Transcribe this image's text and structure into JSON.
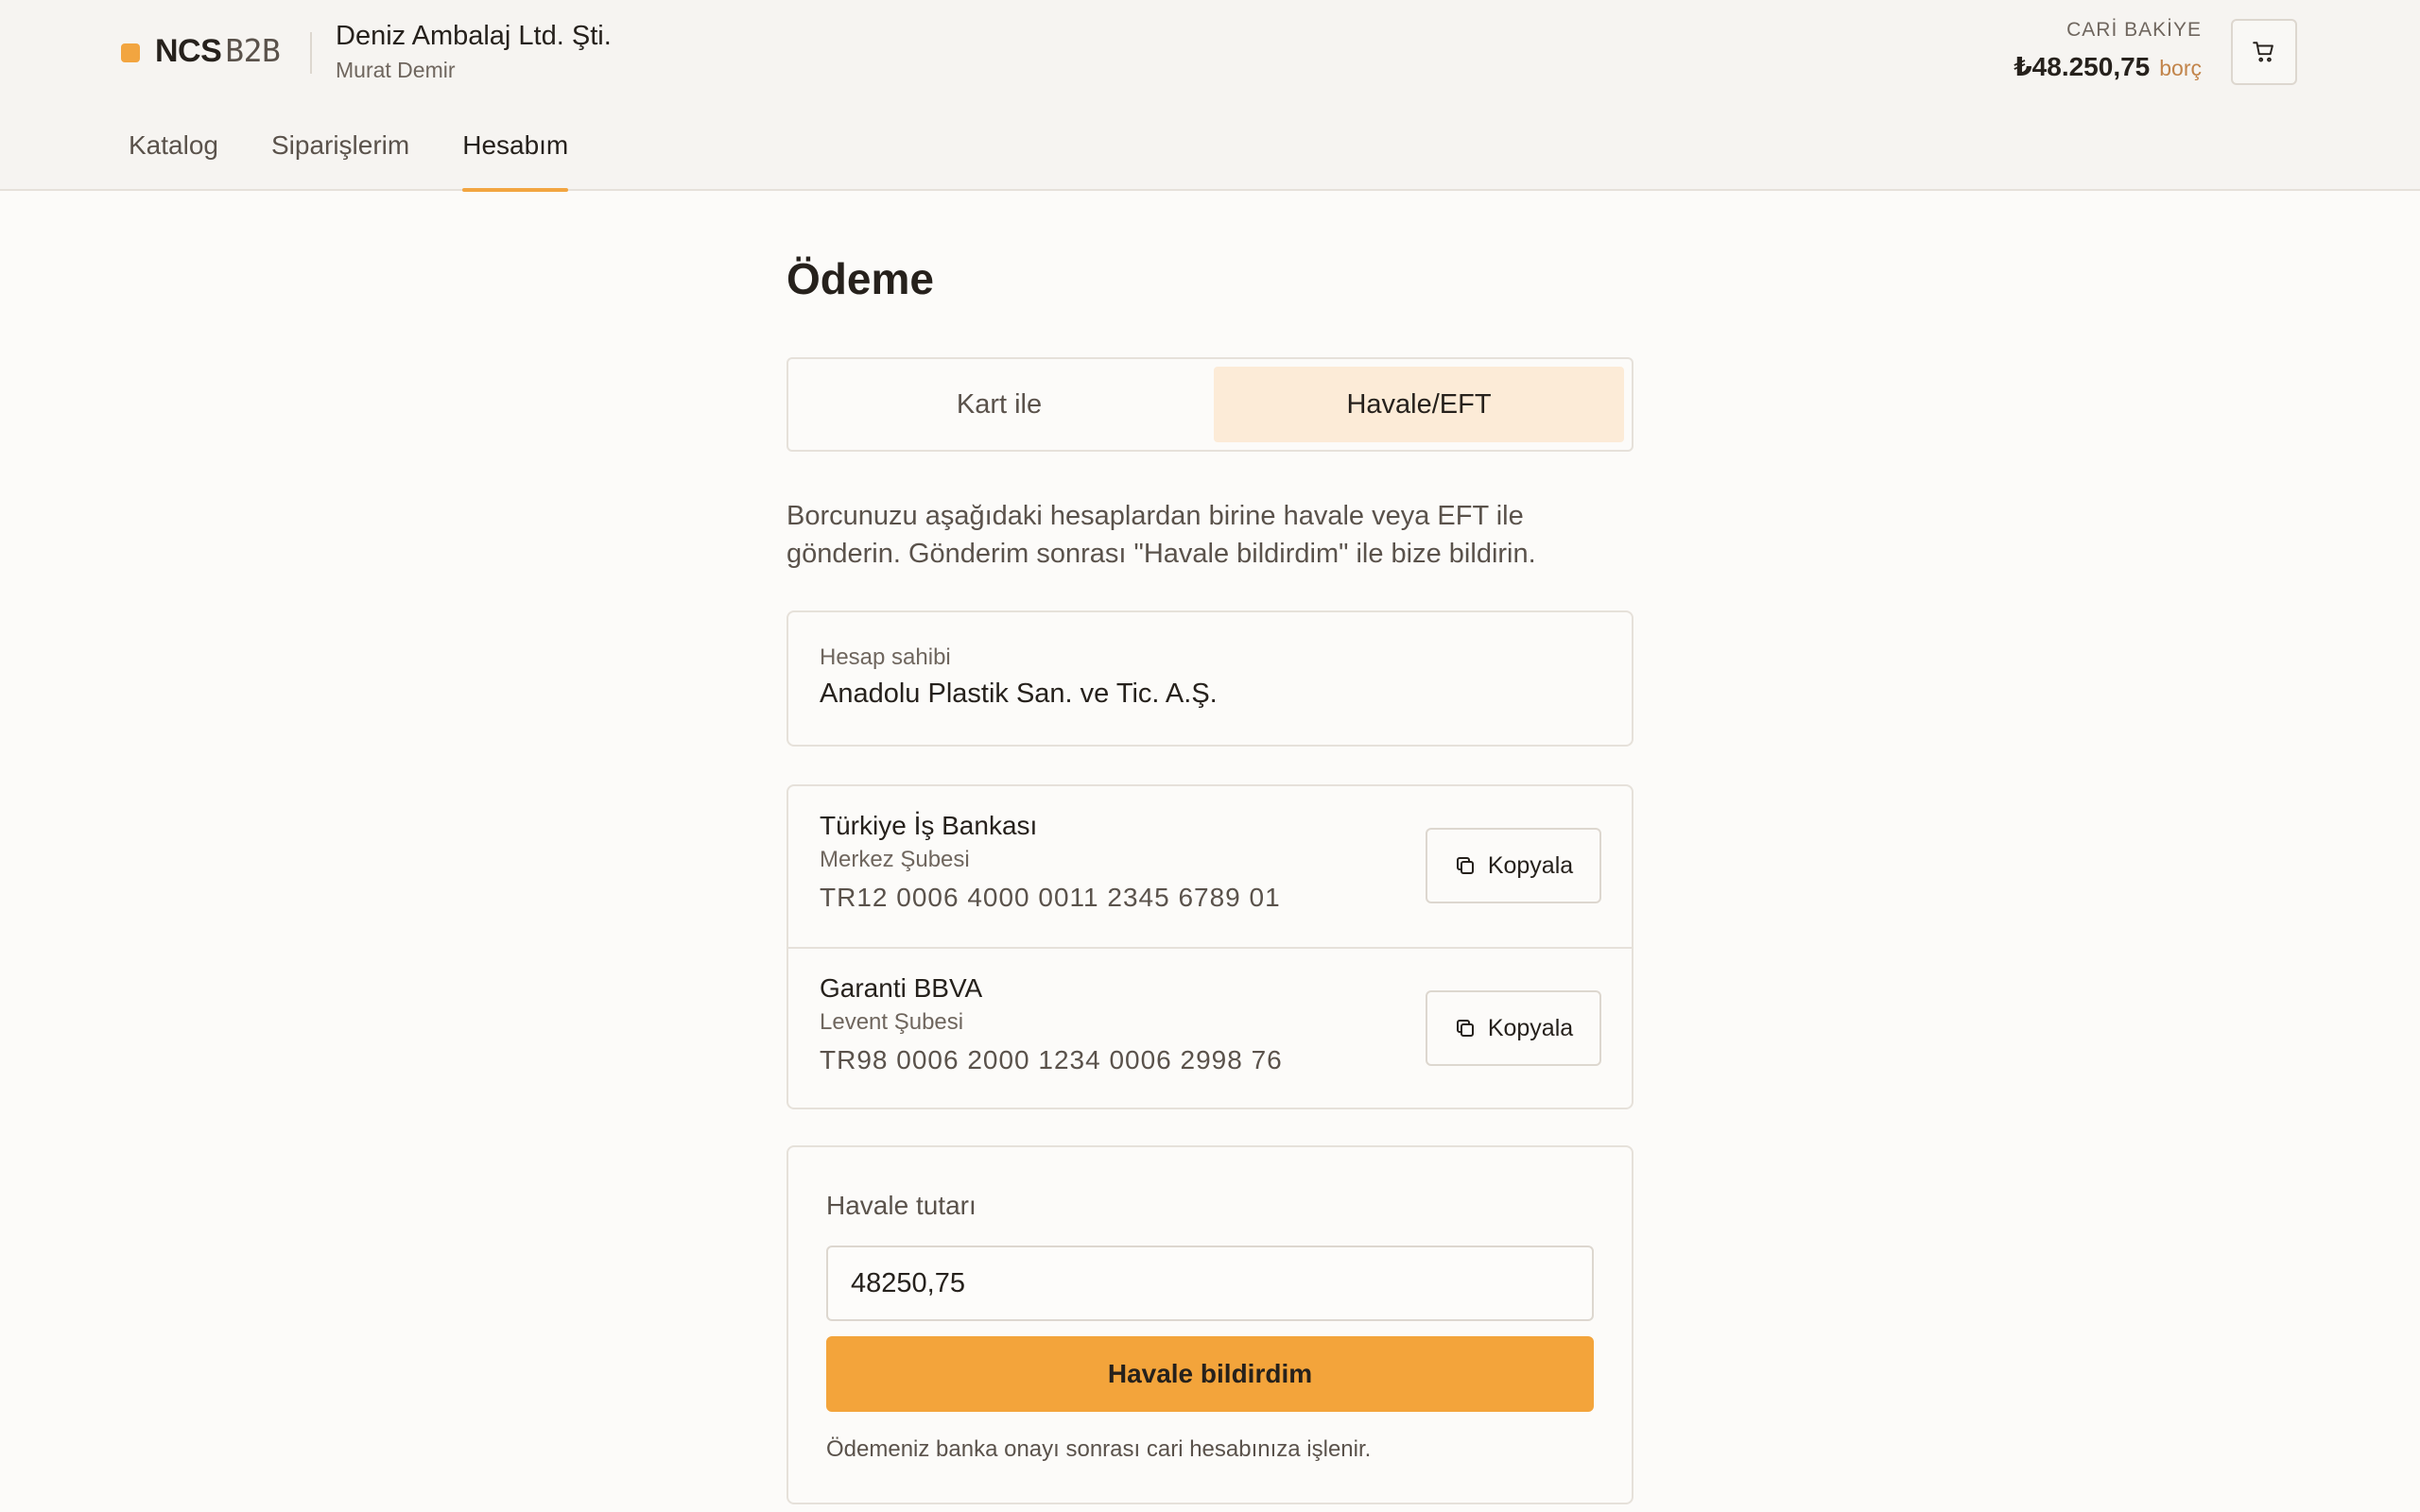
{
  "header": {
    "brand_main": "NCS",
    "brand_sub": "B2B",
    "company": "Deniz Ambalaj Ltd. Şti.",
    "user": "Murat Demir",
    "balance_label": "CARİ BAKİYE",
    "balance_amount": "₺48.250,75",
    "balance_tag": "borç",
    "cart_icon": "cart-icon"
  },
  "nav": {
    "items": [
      {
        "label": "Katalog"
      },
      {
        "label": "Siparişlerim"
      },
      {
        "label": "Hesabım"
      }
    ],
    "active": "Hesabım"
  },
  "page": {
    "title": "Ödeme",
    "tabs": [
      {
        "label": "Kart ile"
      },
      {
        "label": "Havale/EFT"
      }
    ],
    "selected_tab": "Havale/EFT",
    "description": "Borcunuzu aşağıdaki hesaplardan birine havale veya EFT ile gönderin. Gönderim sonrası \"Havale bildirdim\" ile bize bildirin."
  },
  "owner": {
    "label": "Hesap sahibi",
    "name": "Anadolu Plastik San. ve Tic. A.Ş."
  },
  "accounts": [
    {
      "bank": "Türkiye İş Bankası",
      "branch": "Merkez Şubesi",
      "iban": "TR12 0006 4000 0011 2345 6789 01",
      "copy_label": "Kopyala"
    },
    {
      "bank": "Garanti BBVA",
      "branch": "Levent Şubesi",
      "iban": "TR98 0006 2000 1234 0006 2998 76",
      "copy_label": "Kopyala"
    }
  ],
  "form": {
    "label": "Havale tutarı",
    "amount_value": "48250,75",
    "submit_label": "Havale bildirdim",
    "note": "Ödemeniz banka onayı sonrası cari hesabınıza işlenir."
  },
  "colors": {
    "accent": "#f3a43b",
    "tab_selected_bg": "#fcebd7",
    "debt_text": "#c2844a"
  }
}
